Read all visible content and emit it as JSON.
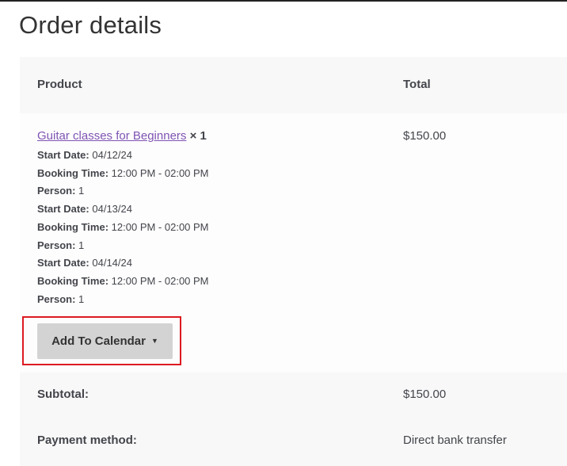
{
  "page": {
    "title": "Order details"
  },
  "table": {
    "headers": {
      "product": "Product",
      "total": "Total"
    },
    "item": {
      "name": "Guitar classes for Beginners",
      "quantity": "× 1",
      "total": "$150.00",
      "meta": [
        {
          "key": "Start Date:",
          "value": "04/12/24"
        },
        {
          "key": "Booking Time:",
          "value": "12:00 PM - 02:00 PM"
        },
        {
          "key": "Person:",
          "value": "1"
        },
        {
          "key": "Start Date:",
          "value": "04/13/24"
        },
        {
          "key": "Booking Time:",
          "value": "12:00 PM - 02:00 PM"
        },
        {
          "key": "Person:",
          "value": "1"
        },
        {
          "key": "Start Date:",
          "value": "04/14/24"
        },
        {
          "key": "Booking Time:",
          "value": "12:00 PM - 02:00 PM"
        },
        {
          "key": "Person:",
          "value": "1"
        }
      ],
      "calendar_button": {
        "label": "Add To Calendar",
        "icon": "caret-down-icon"
      }
    },
    "footer": {
      "subtotal": {
        "label": "Subtotal:",
        "value": "$150.00"
      },
      "payment_method": {
        "label": "Payment method:",
        "value": "Direct bank transfer"
      }
    }
  },
  "colors": {
    "link": "#7f54b3",
    "highlight_border": "#dd1a22",
    "button_bg": "#d3d3d3",
    "header_bg": "#f8f8f8"
  }
}
